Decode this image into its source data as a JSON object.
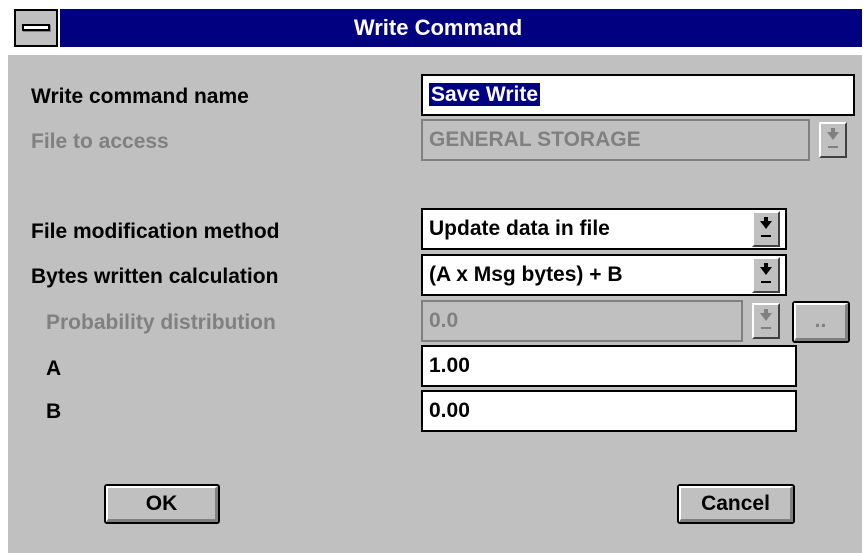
{
  "window": {
    "title": "Write Command"
  },
  "form": {
    "write_command_name": {
      "label": "Write command name",
      "value": "Save Write"
    },
    "file_to_access": {
      "label": "File to access",
      "value": "GENERAL STORAGE",
      "enabled": false
    },
    "file_modification_method": {
      "label": "File modification method",
      "value": "Update data in file"
    },
    "bytes_written_calculation": {
      "label": "Bytes written calculation",
      "value": "(A x Msg bytes) + B"
    },
    "probability_distribution": {
      "label": "Probability distribution",
      "value": "0.0",
      "enabled": false,
      "browse_label": ".."
    },
    "a": {
      "label": "A",
      "value": "1.00"
    },
    "b": {
      "label": "B",
      "value": "0.00"
    }
  },
  "buttons": {
    "ok": "OK",
    "cancel": "Cancel"
  },
  "icons": {
    "system_menu": "system-menu-icon",
    "dropdown": "dropdown-arrow-icon"
  },
  "colors": {
    "titlebar": "#000080",
    "dialog_bg": "#c0c0c0",
    "disabled_text": "#808080"
  }
}
